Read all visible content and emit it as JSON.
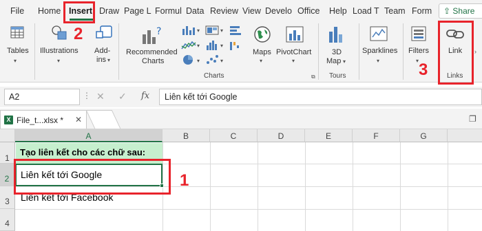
{
  "tabs": [
    "File",
    "Home",
    "Insert",
    "Draw",
    "Page L",
    "Formul",
    "Data",
    "Review",
    "View",
    "Develo",
    "Office",
    "Help",
    "Load T",
    "Team",
    "Form"
  ],
  "share_label": "Share",
  "ribbon": {
    "tables": "Tables",
    "illustrations": "Illustrations",
    "addins_1": "Add-",
    "addins_2": "ins",
    "recommended_1": "Recommended",
    "recommended_2": "Charts",
    "maps": "Maps",
    "pivotchart": "PivotChart",
    "map3d_1": "3D",
    "map3d_2": "Map",
    "sparklines": "Sparklines",
    "filters": "Filters",
    "link": "Link",
    "group_charts": "Charts",
    "group_tours": "Tours",
    "group_links": "Links"
  },
  "formula": {
    "name_box": "A2",
    "cancel": "✕",
    "enter": "✓",
    "fx": "fx",
    "value": "Liên kết tới Google"
  },
  "workbook": {
    "tab_title": "File_t...xlsx *",
    "close": "✕",
    "excel_glyph": "X"
  },
  "grid": {
    "columns": [
      "A",
      "B",
      "C",
      "D",
      "E",
      "F",
      "G"
    ],
    "rows": [
      "1",
      "2",
      "3",
      "4"
    ],
    "cells": {
      "A1": "Tạo liên kết cho các chữ sau:",
      "A2": "Liên kết tới Google",
      "A3": "Liên kết tới Facebook"
    }
  },
  "annotations": [
    "1",
    "2",
    "3"
  ],
  "colors": {
    "accent": "#217346",
    "annotation": "#e8232b",
    "highlight_fill": "#c6efce"
  }
}
